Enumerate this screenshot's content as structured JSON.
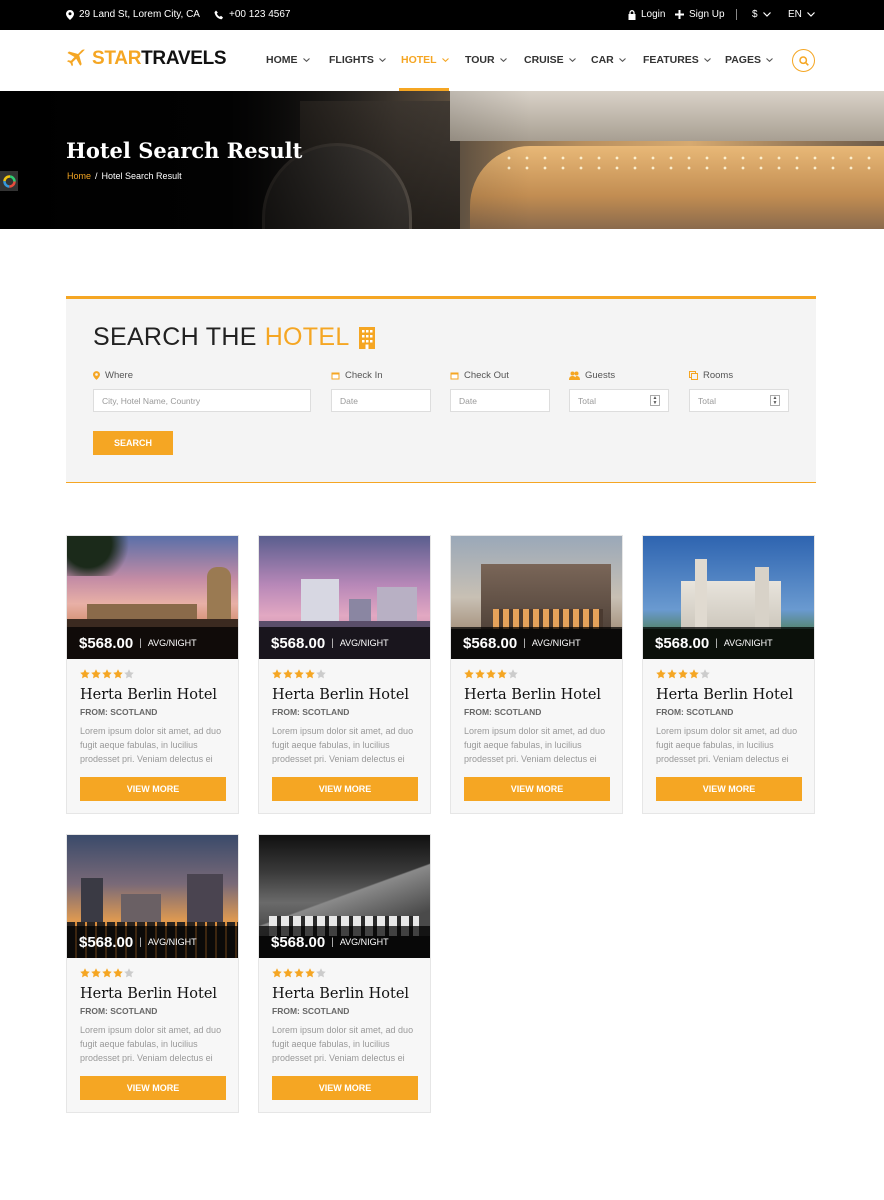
{
  "topbar": {
    "address": "29 Land St, Lorem City, CA",
    "phone": "+00 123 4567",
    "login": "Login",
    "signup": "Sign Up",
    "currency": "$",
    "language": "EN"
  },
  "logo": {
    "part1": "STAR",
    "part2": "TRAVELS"
  },
  "nav": {
    "items": [
      "HOME",
      "FLIGHTS",
      "HOTEL",
      "TOUR",
      "CRUISE",
      "CAR",
      "FEATURES",
      "PAGES"
    ],
    "active": "HOTEL"
  },
  "hero": {
    "title": "Hotel Search Result",
    "breadcrumb_home": "Home",
    "breadcrumb_sep": "/",
    "breadcrumb_current": "Hotel Search Result"
  },
  "search": {
    "title_part1": "SEARCH THE",
    "title_part2": "HOTEL",
    "where_label": "Where",
    "where_placeholder": "City, Hotel Name, Country",
    "checkin_label": "Check In",
    "checkin_placeholder": "Date",
    "checkout_label": "Check Out",
    "checkout_placeholder": "Date",
    "guests_label": "Guests",
    "guests_placeholder": "Total",
    "rooms_label": "Rooms",
    "rooms_placeholder": "Total",
    "button": "SEARCH"
  },
  "colors": {
    "accent": "#f5a623",
    "dark": "#000000"
  },
  "hotels": [
    {
      "price": "$568.00",
      "unit": "AVG/NIGHT",
      "rating": 4,
      "name": "Herta Berlin Hotel",
      "from": "FROM: SCOTLAND",
      "desc": "Lorem ipsum dolor sit amet, ad duo fugit aeque fabulas, in lucilius prodesset pri. Veniam delectus ei",
      "button": "VIEW MORE"
    },
    {
      "price": "$568.00",
      "unit": "AVG/NIGHT",
      "rating": 4,
      "name": "Herta Berlin Hotel",
      "from": "FROM: SCOTLAND",
      "desc": "Lorem ipsum dolor sit amet, ad duo fugit aeque fabulas, in lucilius prodesset pri. Veniam delectus ei",
      "button": "VIEW MORE"
    },
    {
      "price": "$568.00",
      "unit": "AVG/NIGHT",
      "rating": 4,
      "name": "Herta Berlin Hotel",
      "from": "FROM: SCOTLAND",
      "desc": "Lorem ipsum dolor sit amet, ad duo fugit aeque fabulas, in lucilius prodesset pri. Veniam delectus ei",
      "button": "VIEW MORE"
    },
    {
      "price": "$568.00",
      "unit": "AVG/NIGHT",
      "rating": 4,
      "name": "Herta Berlin Hotel",
      "from": "FROM: SCOTLAND",
      "desc": "Lorem ipsum dolor sit amet, ad duo fugit aeque fabulas, in lucilius prodesset pri. Veniam delectus ei",
      "button": "VIEW MORE"
    },
    {
      "price": "$568.00",
      "unit": "AVG/NIGHT",
      "rating": 4,
      "name": "Herta Berlin Hotel",
      "from": "FROM: SCOTLAND",
      "desc": "Lorem ipsum dolor sit amet, ad duo fugit aeque fabulas, in lucilius prodesset pri. Veniam delectus ei",
      "button": "VIEW MORE"
    },
    {
      "price": "$568.00",
      "unit": "AVG/NIGHT",
      "rating": 4,
      "name": "Herta Berlin Hotel",
      "from": "FROM: SCOTLAND",
      "desc": "Lorem ipsum dolor sit amet, ad duo fugit aeque fabulas, in lucilius prodesset pri. Veniam delectus ei",
      "button": "VIEW MORE"
    }
  ]
}
